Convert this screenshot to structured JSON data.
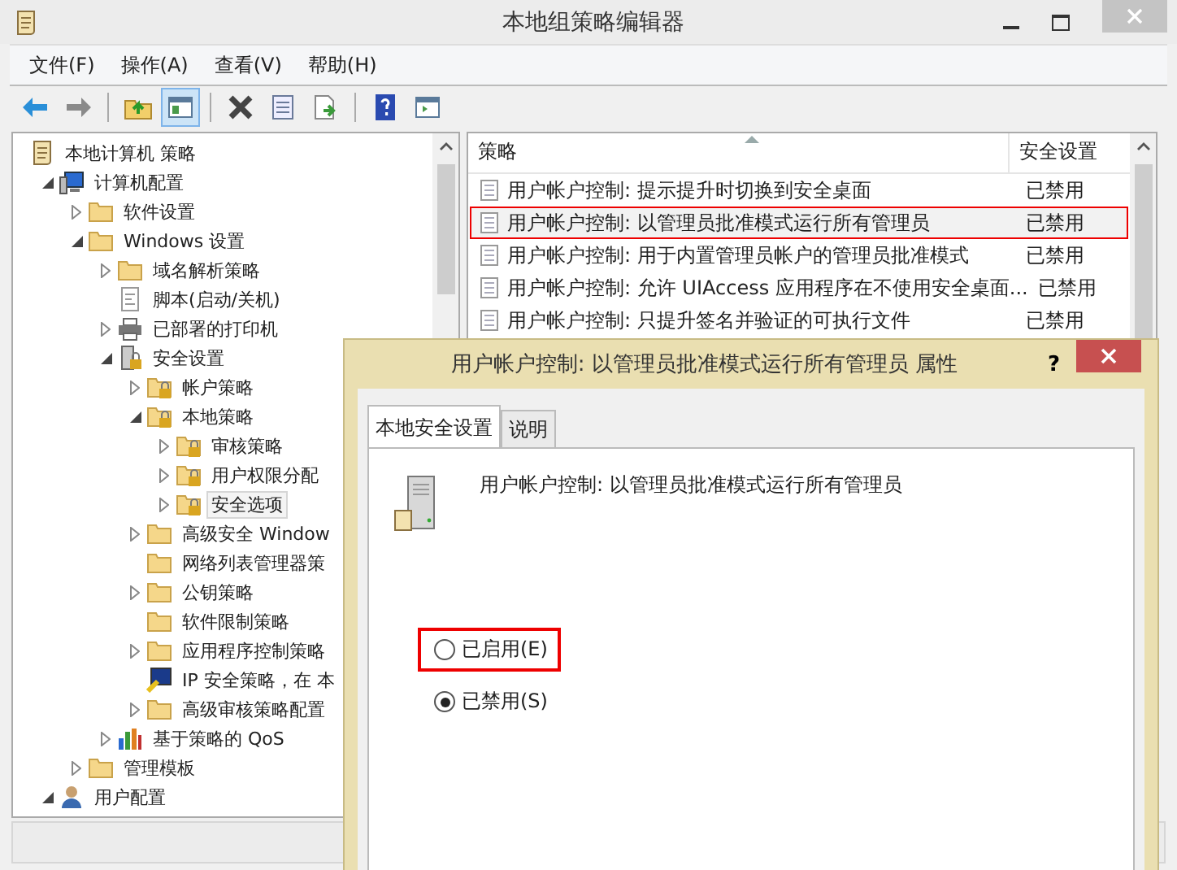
{
  "window": {
    "title": "本地组策略编辑器"
  },
  "menu": [
    "文件(F)",
    "操作(A)",
    "查看(V)",
    "帮助(H)"
  ],
  "toolbar": [
    {
      "kind": "back"
    },
    {
      "kind": "forward"
    },
    {
      "kind": "sep"
    },
    {
      "kind": "up"
    },
    {
      "kind": "pane",
      "selected": true
    },
    {
      "kind": "sep"
    },
    {
      "kind": "delete"
    },
    {
      "kind": "properties"
    },
    {
      "kind": "export"
    },
    {
      "kind": "sep"
    },
    {
      "kind": "help"
    },
    {
      "kind": "view"
    }
  ],
  "tree": [
    {
      "label": "本地计算机 策略",
      "kind": "policy",
      "selected": false,
      "children": [
        {
          "label": "计算机配置",
          "kind": "computer",
          "expanded": true,
          "selected": false,
          "children": [
            {
              "label": "软件设置",
              "kind": "folder",
              "expanded": false,
              "selected": false
            },
            {
              "label": "Windows 设置",
              "kind": "folder",
              "expanded": true,
              "selected": false,
              "children": [
                {
                  "label": "域名解析策略",
                  "kind": "folder",
                  "expanded": false,
                  "selected": false
                },
                {
                  "label": "脚本(启动/关机)",
                  "kind": "script",
                  "selected": false
                },
                {
                  "label": "已部署的打印机",
                  "kind": "printer",
                  "expanded": false,
                  "selected": false
                },
                {
                  "label": "安全设置",
                  "kind": "security",
                  "expanded": true,
                  "selected": false,
                  "children": [
                    {
                      "label": "帐户策略",
                      "kind": "lockfolder",
                      "expanded": false,
                      "selected": false
                    },
                    {
                      "label": "本地策略",
                      "kind": "lockfolder",
                      "expanded": true,
                      "selected": false,
                      "children": [
                        {
                          "label": "审核策略",
                          "kind": "lockfolder",
                          "expanded": false,
                          "selected": false
                        },
                        {
                          "label": "用户权限分配",
                          "kind": "lockfolder",
                          "expanded": false,
                          "selected": false
                        },
                        {
                          "label": "安全选项",
                          "kind": "lockfolder",
                          "expanded": false,
                          "selected": true
                        }
                      ]
                    },
                    {
                      "label": "高级安全 Window",
                      "kind": "folder",
                      "expanded": false,
                      "selected": false
                    },
                    {
                      "label": "网络列表管理器策",
                      "kind": "folder",
                      "selected": false
                    },
                    {
                      "label": "公钥策略",
                      "kind": "folder",
                      "expanded": false,
                      "selected": false
                    },
                    {
                      "label": "软件限制策略",
                      "kind": "folder",
                      "selected": false
                    },
                    {
                      "label": "应用程序控制策略",
                      "kind": "folder",
                      "expanded": false,
                      "selected": false
                    },
                    {
                      "label": "IP 安全策略，在 本",
                      "kind": "ip",
                      "selected": false
                    },
                    {
                      "label": "高级审核策略配置",
                      "kind": "folder",
                      "expanded": false,
                      "selected": false
                    }
                  ]
                },
                {
                  "label": "基于策略的 QoS",
                  "kind": "chart",
                  "expanded": false,
                  "selected": false
                }
              ]
            },
            {
              "label": "管理模板",
              "kind": "folder",
              "expanded": false,
              "selected": false
            }
          ]
        },
        {
          "label": "用户配置",
          "kind": "user",
          "expanded": true,
          "selected": false
        }
      ]
    }
  ],
  "list": {
    "columns": [
      "策略",
      "安全设置"
    ],
    "rows": [
      {
        "policy": "用户帐户控制: 提示提升时切换到安全桌面",
        "setting": "已禁用",
        "selected": false,
        "highlighted": false
      },
      {
        "policy": "用户帐户控制: 以管理员批准模式运行所有管理员",
        "setting": "已禁用",
        "selected": true,
        "highlighted": true
      },
      {
        "policy": "用户帐户控制: 用于内置管理员帐户的管理员批准模式",
        "setting": "已禁用",
        "selected": false,
        "highlighted": false
      },
      {
        "policy": "用户帐户控制: 允许 UIAccess 应用程序在不使用安全桌面...",
        "setting": "已禁用",
        "selected": false,
        "highlighted": false
      },
      {
        "policy": "用户帐户控制: 只提升签名并验证的可执行文件",
        "setting": "已禁用",
        "selected": false,
        "highlighted": false
      }
    ]
  },
  "dialog": {
    "title": "用户帐户控制: 以管理员批准模式运行所有管理员 属性",
    "help": "?",
    "tabs": [
      {
        "label": "本地安全设置",
        "selected": true
      },
      {
        "label": "说明",
        "selected": false
      }
    ],
    "policy_name": "用户帐户控制: 以管理员批准模式运行所有管理员",
    "options": [
      {
        "label": "已启用(E)",
        "checked": false,
        "highlighted": true
      },
      {
        "label": "已禁用(S)",
        "checked": true,
        "highlighted": false
      }
    ]
  }
}
